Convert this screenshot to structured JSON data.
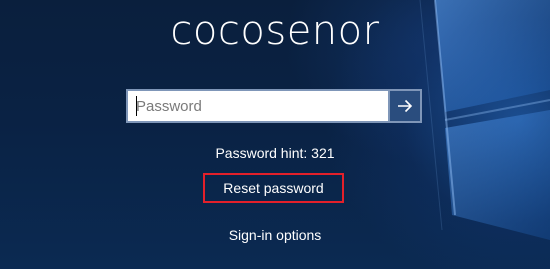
{
  "user": {
    "name": "cocosenor"
  },
  "password": {
    "placeholder": "Password",
    "value": ""
  },
  "submit": {
    "icon": "arrow-right-icon"
  },
  "hint": {
    "text": "Password hint: 321"
  },
  "reset": {
    "label": "Reset password",
    "highlight_color": "#e3202a"
  },
  "signin_options": {
    "label": "Sign-in options"
  },
  "colors": {
    "background": "#0a2244",
    "accent": "#2a4d7e",
    "input_border": "#7f96b8"
  }
}
